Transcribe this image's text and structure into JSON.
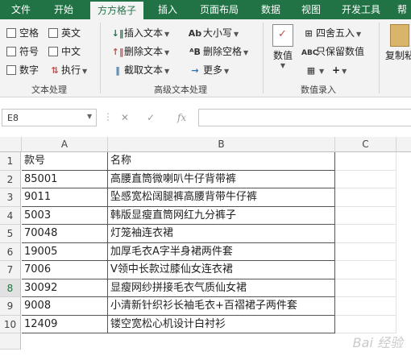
{
  "ribbon_tabs": [
    "文件",
    "开始",
    "方方格子",
    "插入",
    "页面布局",
    "数据",
    "视图",
    "开发工具",
    "帮"
  ],
  "active_tab": "方方格子",
  "text_processing": {
    "label": "文本处理",
    "checkboxes": [
      "空格",
      "英文",
      "符号",
      "中文",
      "数字"
    ],
    "execute": "执行"
  },
  "advanced_text": {
    "label": "高级文本处理",
    "insert": "插入文本",
    "delete": "删除文本",
    "extract": "截取文本",
    "case": "大小写",
    "remove_space": "删除空格",
    "more": "更多"
  },
  "data_entry": {
    "label": "数值录入",
    "value": "数值",
    "round": "四舍五入",
    "keep_value": "只保留数值",
    "plus": "+",
    "copy_paste": "复制粘贴"
  },
  "formula_bar": {
    "name_box": "E8",
    "cancel": "✕",
    "confirm": "✓",
    "fx": "fx",
    "formula": ""
  },
  "columns": [
    "A",
    "B",
    "C"
  ],
  "selected_row": 8,
  "rows": [
    {
      "num": "1",
      "a": "款号",
      "b": "名称"
    },
    {
      "num": "2",
      "a": "85001",
      "b": "高腰直筒微喇叭牛仔背带裤"
    },
    {
      "num": "3",
      "a": "9011",
      "b": "坠感宽松阔腿裤高腰背带牛仔裤"
    },
    {
      "num": "4",
      "a": "5003",
      "b": "韩版显瘦直筒网红九分裤子"
    },
    {
      "num": "5",
      "a": "70048",
      "b": "灯笼袖连衣裙"
    },
    {
      "num": "6",
      "a": "19005",
      "b": "加厚毛衣A字半身裙两件套"
    },
    {
      "num": "7",
      "a": "7006",
      "b": "V领中长款过膝仙女连衣裙"
    },
    {
      "num": "8",
      "a": "30092",
      "b": "显瘦网纱拼接毛衣气质仙女裙"
    },
    {
      "num": "9",
      "a": "9008",
      "b": "小清新针织衫长袖毛衣+百褶裙子两件套"
    },
    {
      "num": "10",
      "a": "12409",
      "b": "镂空宽松心机设计白衬衫"
    }
  ],
  "watermark": "Bai 经验"
}
